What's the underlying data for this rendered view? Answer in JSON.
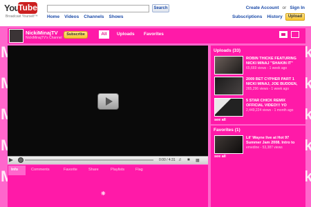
{
  "masthead": {
    "logo_you": "You",
    "logo_tube": "Tube",
    "tagline": "Broadcast Yourself™",
    "search_button": "Search",
    "search_value": "",
    "nav": [
      "Home",
      "Videos",
      "Channels",
      "Shows"
    ],
    "create_account": "Create Account",
    "or": "or",
    "sign_in": "Sign In",
    "right_nav": [
      "Subscriptions",
      "History"
    ],
    "upload": "Upload"
  },
  "channel": {
    "name": "NickiMinajTV",
    "subtitle": "NickiMinajTV's Channel",
    "subscribe": "Subscribe",
    "tabs": {
      "all": "All",
      "uploads": "Uploads",
      "favorites": "Favorites"
    }
  },
  "player": {
    "time": "0:00 / 4:31"
  },
  "info_tabs": [
    "Info",
    "Comments",
    "Favorite",
    "Share",
    "Playlists",
    "Flag"
  ],
  "uploads": {
    "heading": "Uploads (33)",
    "items": [
      {
        "title": "ROBIN THICKE FEATURING NICKI MINAJ \"SHAKIN IT\"",
        "meta": "65,669 views - 1 week ago"
      },
      {
        "title": "2009 BET CYPHER PART 1 NICKI MINAJ, JOE BUDDEN,",
        "meta": "265,296 views - 1 week ago"
      },
      {
        "title": "5 STAR CHICK REMIX OFFICIAL VIDEO!!! YO",
        "meta": "2,449,224 views - 1 month ago"
      }
    ],
    "see_all": "see all"
  },
  "favorites": {
    "heading": "Favorites (1)",
    "items": [
      {
        "title": "Lil' Wayne live at Hot 97 Summer Jam 2008. Intro to",
        "meta": "emedine - 53,387 views"
      }
    ],
    "see_all": "see all"
  },
  "colors": {
    "accent": "#ff1aa8",
    "background": "#ff66cc",
    "link": "#1a4aa8"
  }
}
